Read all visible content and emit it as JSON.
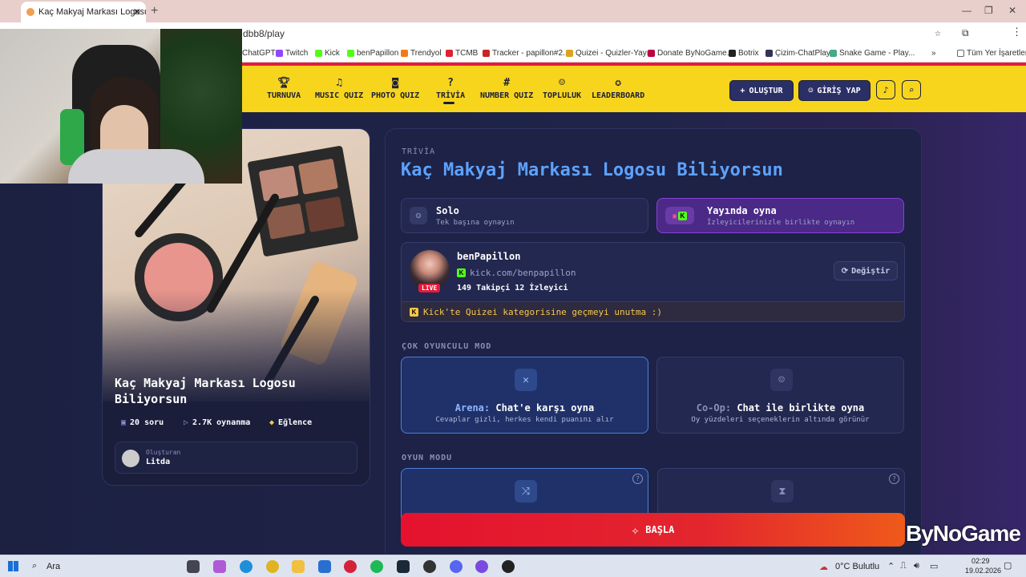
{
  "browser": {
    "tab_title": "Kaç Makyaj Markası Logosu Bi",
    "tab_close": "✕",
    "new_tab": "+",
    "url_tail": "dbb8/play",
    "bookmarks": [
      "ChatGPT",
      "Twitch",
      "Kick",
      "benPapillon",
      "Trendyol",
      "TCMB",
      "Tracker - papillon#2...",
      "Quizei - Quizler-Yayın",
      "Donate ByNoGame...",
      "Botrix",
      "Çizim-ChatPlay",
      "Snake Game - Play..."
    ],
    "bookmarks_more": "»",
    "all_bookmarks": "Tüm Yer İşaretleri"
  },
  "nav": {
    "items": [
      {
        "label": "TURNUVA",
        "icon": "trophy-icon"
      },
      {
        "label": "MUSIC QUIZ",
        "icon": "music-icon"
      },
      {
        "label": "PHOTO QUIZ",
        "icon": "camera-icon"
      },
      {
        "label": "TRİVİA",
        "icon": "question-icon"
      },
      {
        "label": "NUMBER QUIZ",
        "icon": "hash-icon"
      },
      {
        "label": "TOPLULUK",
        "icon": "users-icon"
      },
      {
        "label": "LEADERBOARD",
        "icon": "medal-icon"
      }
    ],
    "create_label": "OLUŞTUR",
    "login_label": "GİRİŞ YAP"
  },
  "quiz": {
    "title": "Kaç Makyaj Markası Logosu Biliyorsun",
    "card_title": "Kaç Makyaj Markası Logosu Biliyorsun",
    "category": "TRİVİA",
    "questions": "20 soru",
    "plays": "2.7K oynanma",
    "tag": "Eğlence",
    "creator_label": "Oluşturan",
    "creator_name": "Litda"
  },
  "play_modes": {
    "solo_title": "Solo",
    "solo_sub": "Tek başına oynayın",
    "stream_title": "Yayında oyna",
    "stream_sub": "İzleyicilerinizle birlikte oynayın"
  },
  "streamer": {
    "name": "benPapillon",
    "url": "kick.com/benpapillon",
    "followers": "149",
    "followers_label": "Takipçi",
    "viewers": "12",
    "viewers_label": "İzleyici",
    "live": "LIVE",
    "change_label": "Değiştir",
    "notice": "Kick'te Quizei kategorisine geçmeyi unutma :)"
  },
  "multiplayer": {
    "section": "ÇOK OYUNCULU MOD",
    "arena_prefix": "Arena:",
    "arena_title": "Chat'e karşı oyna",
    "arena_sub": "Cevaplar gizli, herkes kendi puanını alır",
    "coop_prefix": "Co-Op:",
    "coop_title": "Chat ile birlikte oyna",
    "coop_sub": "Oy yüzdeleri seçeneklerin altında görünür"
  },
  "game_mode": {
    "section": "OYUN MODU",
    "help": "?"
  },
  "start_label": "BAŞLA",
  "brand": "ByNoGame",
  "taskbar": {
    "search": "Ara",
    "weather": "0°C  Bulutlu",
    "time": "02:29",
    "date": "19.02.2026"
  }
}
